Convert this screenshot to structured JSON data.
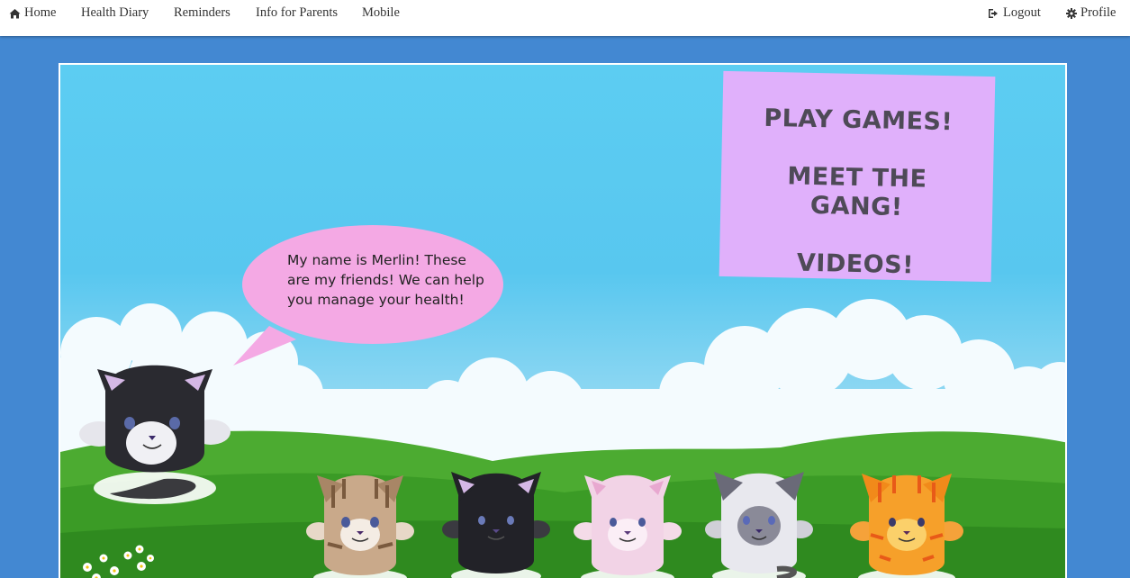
{
  "nav": {
    "left": [
      {
        "icon": "home-icon",
        "label": "Home"
      },
      {
        "label": "Health Diary"
      },
      {
        "label": "Reminders"
      },
      {
        "label": "Info for Parents"
      },
      {
        "label": "Mobile"
      }
    ],
    "right": [
      {
        "icon": "logout-icon",
        "label": "Logout"
      },
      {
        "icon": "gear-icon",
        "label": "Profile"
      }
    ]
  },
  "sign": {
    "line1": "PLAY GAMES!",
    "line2a": "MEET THE",
    "line2b": "GANG!",
    "line3": "VIDEOS!"
  },
  "speech": {
    "text": "My name is Merlin! These are my friends! We can help you manage your health!"
  },
  "colors": {
    "page_bg": "#4388d2",
    "sign_bg": "#e0b0fb",
    "bubble_bg": "#f4a9e4",
    "grass": "#3f9c2c"
  },
  "characters": [
    "merlin-black-white-cat",
    "tabby-cat",
    "black-cat",
    "pink-cat",
    "grey-white-cat",
    "orange-cat"
  ]
}
